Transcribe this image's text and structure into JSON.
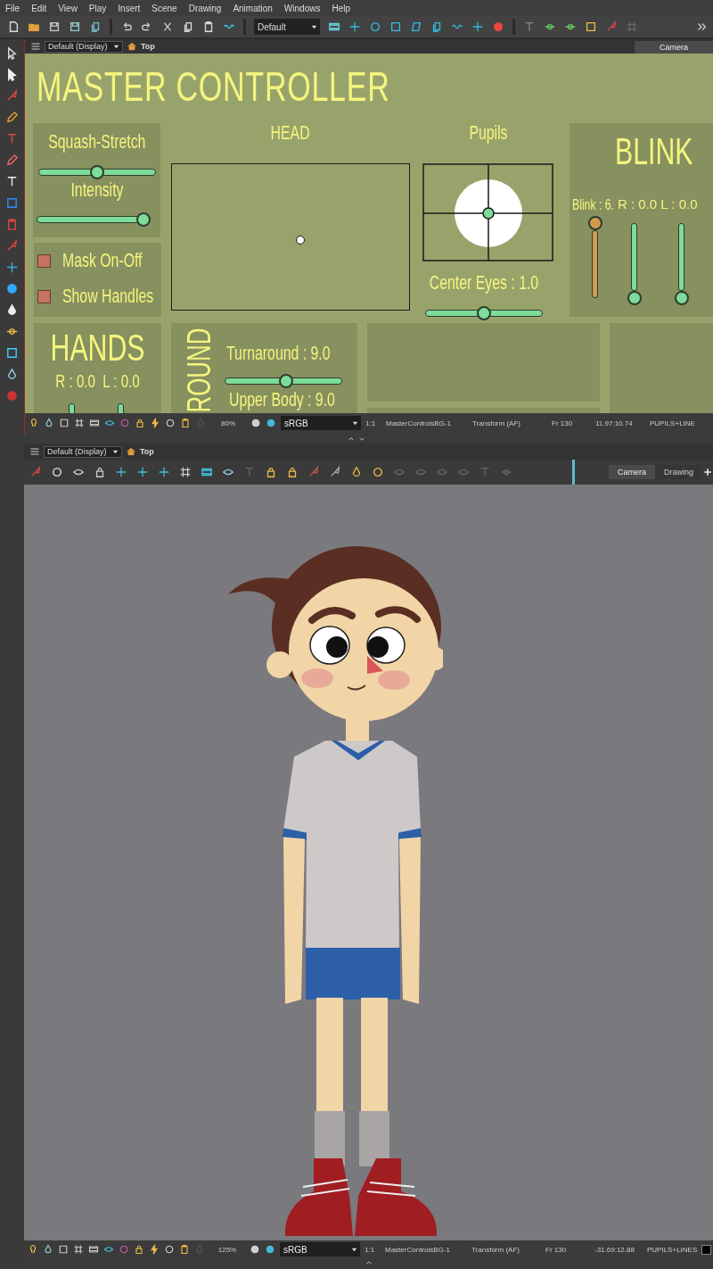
{
  "menu": [
    {
      "label": "File"
    },
    {
      "label": "Edit"
    },
    {
      "label": "View"
    },
    {
      "label": "Play"
    },
    {
      "label": "Insert"
    },
    {
      "label": "Scene"
    },
    {
      "label": "Drawing"
    },
    {
      "label": "Animation"
    },
    {
      "label": "Windows"
    },
    {
      "label": "Help"
    }
  ],
  "main_toolbar": {
    "preset": "Default"
  },
  "top_view": {
    "display": "Default (Display)",
    "breadcrumb": "Top",
    "tabs": [
      {
        "label": "Camera",
        "selected": true
      }
    ],
    "controller": {
      "title": "MASTER CONTROLLER",
      "squash_stretch": {
        "label": "Squash-Stretch",
        "level": 0.5
      },
      "intensity": {
        "label": "Intensity",
        "level": 1
      },
      "toggles": [
        {
          "label": "Mask On-Off"
        },
        {
          "label": "Show Handles"
        }
      ],
      "hands": {
        "title": "HANDS",
        "readout": "R : 0.0  L : 0.0"
      },
      "head": {
        "label": "HEAD"
      },
      "pupils": {
        "label": "Pupils"
      },
      "center_eyes": {
        "label": "Center Eyes : 1.0",
        "level": 0.5
      },
      "blink": {
        "title": "BLINK",
        "readout": "Blink : 6.",
        "sides_readout": "R : 0.0 L : 0.0",
        "sliders": [
          {
            "level": 1,
            "color": "#d39a4c"
          },
          {
            "level": 0,
            "color": "#7ddc9a"
          },
          {
            "level": 0,
            "color": "#7ddc9a"
          }
        ]
      },
      "turnaround": {
        "title": "ROUND",
        "label": "Turnaround : 9.0",
        "level": 0.53,
        "secondary_label": "Upper Body : 9.0"
      }
    },
    "status_bar": {
      "zoom": "80%",
      "color_space": "sRGB",
      "scale": "1:1",
      "layer": "MasterControlsBG-1",
      "tool": "Transform (AF)",
      "frame": "Fr 130",
      "coordinates": "11.97:10.74",
      "selection": "PUPILS+LINE"
    }
  },
  "bottom_view": {
    "display": "Default (Display)",
    "breadcrumb": "Top",
    "tabs": [
      {
        "label": "Camera",
        "selected": true
      },
      {
        "label": "Drawing",
        "selected": false
      }
    ],
    "status_bar": {
      "zoom": "125%",
      "color_space": "sRGB",
      "scale": "1:1",
      "layer": "MasterControlsBG-1",
      "tool": "Transform (AF)",
      "frame": "Fr 130",
      "coordinates": "-31.69:12.88",
      "selection": "PUPILS+LINES"
    }
  }
}
